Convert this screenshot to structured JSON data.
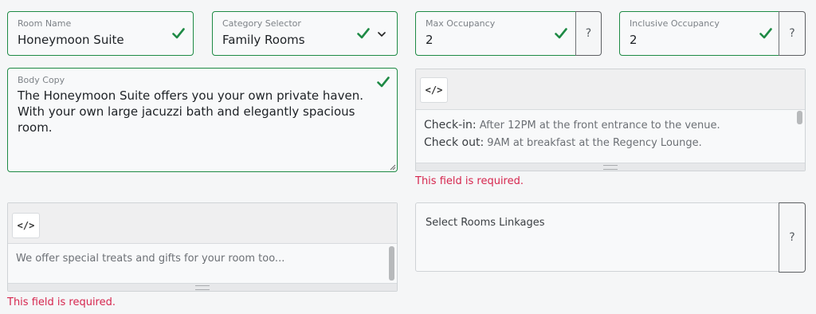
{
  "room_name": {
    "label": "Room Name",
    "value": "Honeymoon Suite"
  },
  "category": {
    "label": "Category Selector",
    "value": "Family Rooms"
  },
  "max_occupancy": {
    "label": "Max Occupancy",
    "value": "2",
    "help": "?"
  },
  "inclusive_occupancy": {
    "label": "Inclusive Occupancy",
    "value": "2",
    "help": "?"
  },
  "body_copy": {
    "label": "Body Copy",
    "value": "The Honeymoon Suite offers you your own private haven. With your own large jacuzzi bath and elegantly spacious room."
  },
  "checkin_editor": {
    "code_button": "</>",
    "lines": [
      {
        "key": "Check-in:",
        "text": " After 12PM at the front entrance to the venue."
      },
      {
        "key": "Check out:",
        "text": " 9AM at breakfast at the Regency Lounge."
      }
    ],
    "error": "This field is required."
  },
  "treats_editor": {
    "code_button": "</>",
    "placeholder": "We offer special treats and gifts for your room too...",
    "error": "This field is required."
  },
  "room_linkages": {
    "label": "Select Rooms Linkages",
    "help": "?"
  },
  "colors": {
    "valid": "#1e8a45",
    "error": "#d6264e"
  },
  "icons": [
    "check-icon",
    "chevron-down-icon",
    "code-icon",
    "help-icon"
  ]
}
